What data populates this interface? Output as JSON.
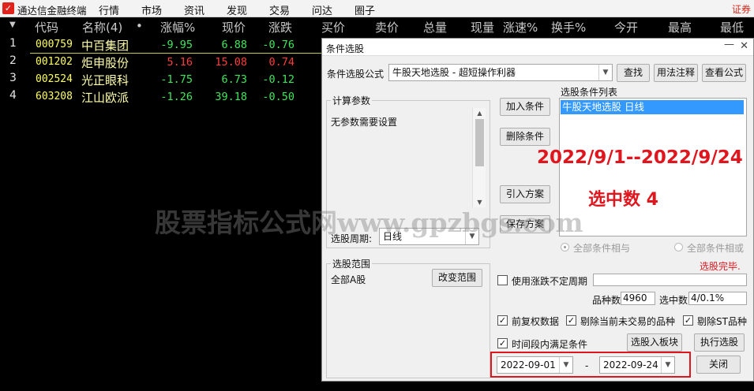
{
  "menubar": {
    "app_title": "通达信金融终端",
    "items": [
      "行情",
      "市场",
      "资讯",
      "发现",
      "交易",
      "问达",
      "圈子"
    ],
    "right_link": "证券"
  },
  "grid": {
    "headers": [
      "代码",
      "名称(4)",
      "•",
      "涨幅%",
      "现价",
      "涨跌",
      "买价",
      "卖价",
      "总量",
      "现量",
      "涨速%",
      "换手%",
      "今开",
      "最高",
      "最低"
    ],
    "rows": [
      {
        "idx": "1",
        "code": "000759",
        "name": "中百集团",
        "chg_pct": "-9.95",
        "price": "6.88",
        "chg": "-0.76",
        "dir": "down"
      },
      {
        "idx": "2",
        "code": "001202",
        "name": "炬申股份",
        "chg_pct": "5.16",
        "price": "15.08",
        "chg": "0.74",
        "dir": "up"
      },
      {
        "idx": "3",
        "code": "002524",
        "name": "光正眼科",
        "chg_pct": "-1.75",
        "price": "6.73",
        "chg": "-0.12",
        "dir": "down"
      },
      {
        "idx": "4",
        "code": "603208",
        "name": "江山欧派",
        "chg_pct": "-1.26",
        "price": "39.18",
        "chg": "-0.50",
        "dir": "down"
      }
    ]
  },
  "watermark": "股票指标公式网www.gpzbgs.com",
  "dialog": {
    "title": "条件选股",
    "formula_label": "条件选股公式",
    "formula_value": "牛股天地选股 - 超短操作利器",
    "btn_find": "查找",
    "btn_usage": "用法注释",
    "btn_view": "查看公式",
    "params_title": "计算参数",
    "params_text": "无参数需要设置",
    "period_label": "选股周期:",
    "period_value": "日线",
    "btn_add": "加入条件",
    "btn_delete": "删除条件",
    "btn_import": "引入方案",
    "btn_save": "保存方案",
    "cond_list_label": "选股条件列表",
    "cond_items": [
      "牛股天地选股  日线"
    ],
    "date_range_overlay": "2022/9/1--2022/9/24",
    "selected_overlay": "选中数 4",
    "radio_and": "全部条件相与",
    "radio_or": "全部条件相或",
    "done_text": "选股完毕.",
    "scope_title": "选股范围",
    "scope_value": "全部A股",
    "btn_change_scope": "改变范围",
    "use_period_label": "使用涨跌不定周期",
    "count_label": "品种数",
    "count_value": "4960",
    "selected_label": "选中数",
    "selected_value": "4/0.1%",
    "chk_fq": "前复权数据",
    "chk_exclude_untraded": "剔除当前未交易的品种",
    "chk_exclude_st": "剔除ST品种",
    "chk_period": "时间段内满足条件",
    "btn_to_block": "选股入板块",
    "btn_execute": "执行选股",
    "date_start": "2022-09-01",
    "date_sep": "-",
    "date_end": "2022-09-24",
    "btn_close": "关闭"
  },
  "colors": {
    "up": "#ff3c3c",
    "down": "#3ce85a",
    "code": "#ffff66",
    "accent_red": "#e0161e",
    "selection": "#3399ff"
  }
}
